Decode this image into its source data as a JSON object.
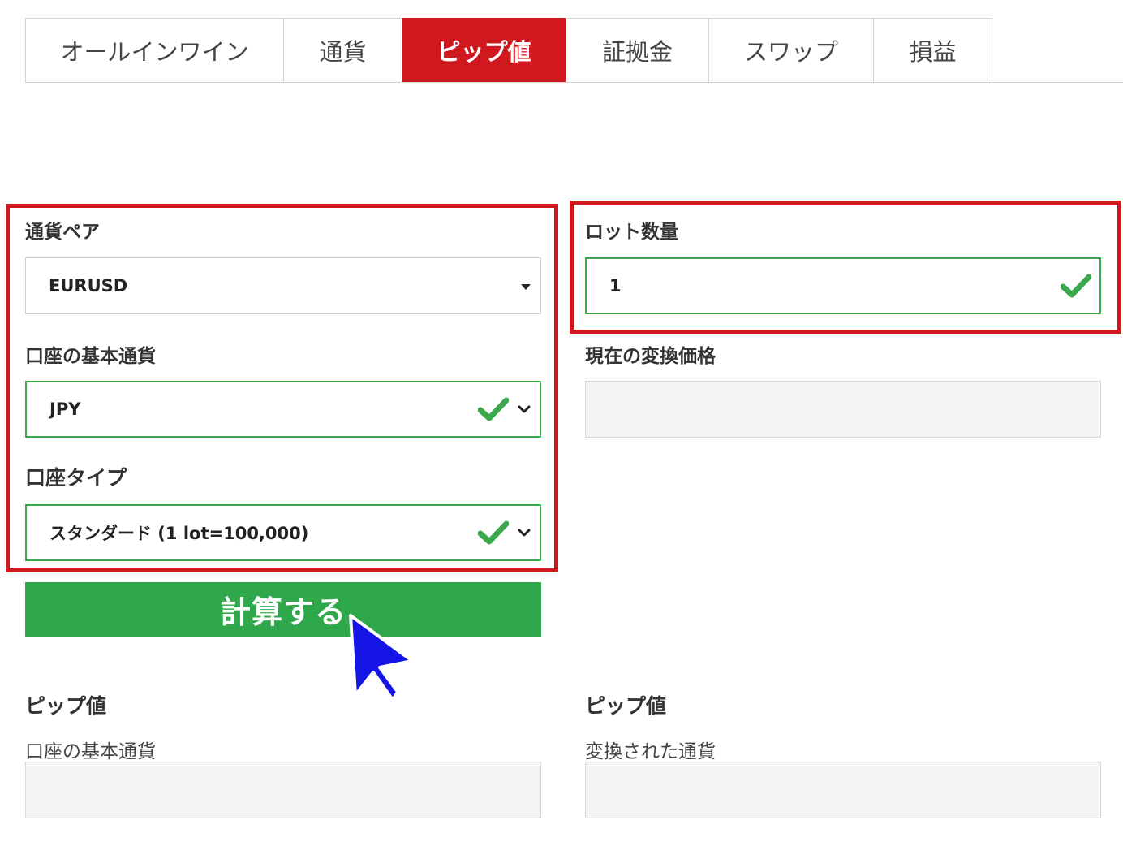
{
  "tabs": [
    {
      "label": "オールインワイン",
      "active": false
    },
    {
      "label": "通貨",
      "active": false
    },
    {
      "label": "ピップ値",
      "active": true
    },
    {
      "label": "証拠金",
      "active": false
    },
    {
      "label": "スワップ",
      "active": false
    },
    {
      "label": "損益",
      "active": false
    }
  ],
  "form": {
    "currency_pair": {
      "label": "通貨ペア",
      "value": "EURUSD"
    },
    "account_base_currency": {
      "label": "口座の基本通貨",
      "value": "JPY"
    },
    "account_type": {
      "label": "口座タイプ",
      "value": "スタンダード (1 lot=100,000)"
    },
    "lot_quantity": {
      "label": "ロット数量",
      "value": "1"
    },
    "current_conversion_price": {
      "label": "現在の変換価格",
      "value": ""
    }
  },
  "calculate_button": {
    "label": "計算する"
  },
  "results": {
    "left": {
      "heading": "ピップ値",
      "sublabel": "口座の基本通貨",
      "value": ""
    },
    "right": {
      "heading": "ピップ値",
      "sublabel": "変換された通貨",
      "value": ""
    }
  },
  "colors": {
    "accent_red": "#d0181f",
    "valid_green": "#3aa84b",
    "button_green": "#2ea84a",
    "cursor_blue": "#1414e6"
  },
  "icons": [
    "chevron-down-icon",
    "check-icon",
    "caret-down-icon",
    "mouse-pointer-icon"
  ]
}
